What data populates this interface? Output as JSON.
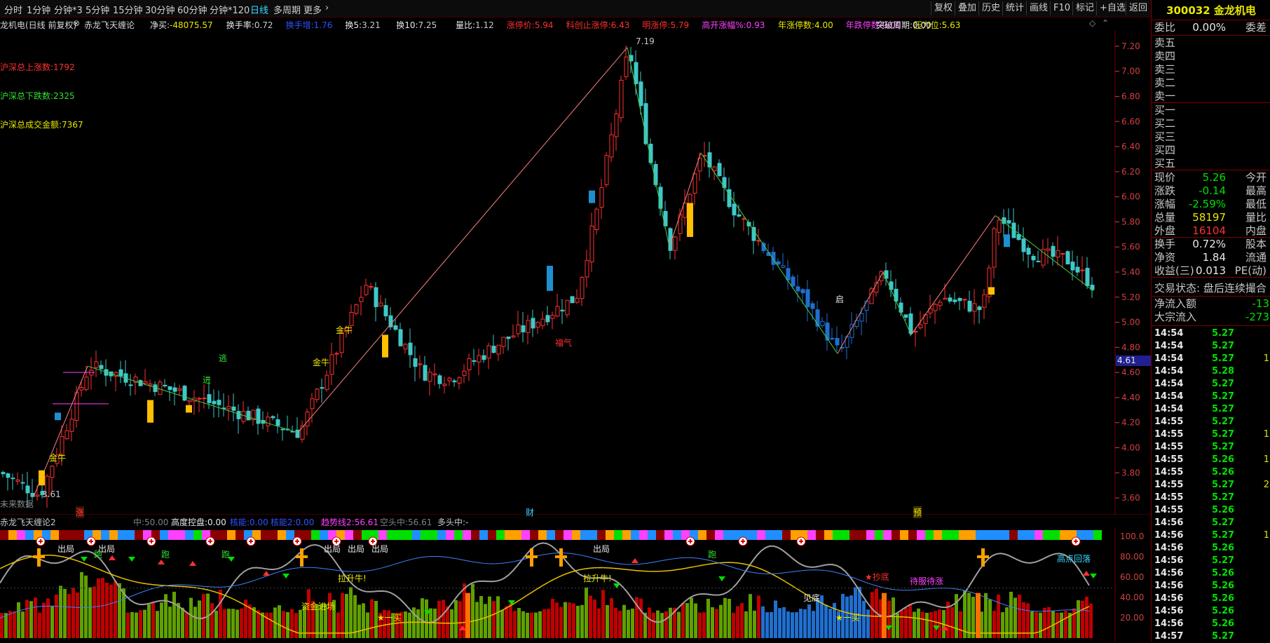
{
  "toolbar": {
    "periods": [
      "分时",
      "1分钟",
      "分钟*3",
      "5分钟",
      "15分钟",
      "30分钟",
      "60分钟",
      "分钟*120",
      "日线",
      "多周期",
      "更多"
    ],
    "active_period": "日线",
    "right_buttons": [
      "复权",
      "叠加",
      "历史",
      "统计",
      "画线",
      "F10",
      "标记",
      "+自选",
      "返回"
    ]
  },
  "chart_header": {
    "stock_label": "龙机电(日线 前复权)",
    "indicator_name": "赤龙飞天缠论",
    "stats": [
      {
        "label": "净买:",
        "value": "-48075.57",
        "color": "#e8e800"
      },
      {
        "label": "换手率:",
        "value": "0.72",
        "color": "#c8c8c8"
      },
      {
        "label": "换手增:",
        "value": "1.76",
        "color": "#3050ff"
      },
      {
        "label": "换5:",
        "value": "3.21",
        "color": "#c8c8c8"
      },
      {
        "label": "换10:",
        "value": "7.25",
        "color": "#c8c8c8"
      },
      {
        "label": "量比:",
        "value": "1.12",
        "color": "#c8c8c8"
      },
      {
        "label": "涨停价:",
        "value": "5.94",
        "color": "#ff3030"
      },
      {
        "label": "科创止涨停:",
        "value": "6.43",
        "color": "#ff3030"
      },
      {
        "label": "明涨停:",
        "value": "5.79",
        "color": "#ff3030"
      },
      {
        "label": "高开涨幅%:",
        "value": "0.93",
        "color": "#ff40ff"
      },
      {
        "label": "年涨停数:",
        "value": "4.00",
        "color": "#e8e800"
      },
      {
        "label": "年跌停数:",
        "value": "0.00",
        "color": "#ff40ff"
      },
      {
        "label": "压力位:",
        "value": "5.63",
        "color": "#e8e800"
      },
      {
        "label": "突破周期:",
        "value": "0.00",
        "color": "#e8e8e8"
      }
    ]
  },
  "left_stats": [
    {
      "text": "沪深总上涨数:1792",
      "color": "#ff3030"
    },
    {
      "text": "沪深总下跌数:2325",
      "color": "#30e030"
    },
    {
      "text": "沪深总成交金额:7367",
      "color": "#e8e800"
    }
  ],
  "price_axis": [
    "7.20",
    "7.00",
    "6.80",
    "6.60",
    "6.40",
    "6.20",
    "6.00",
    "5.80",
    "5.60",
    "5.40",
    "5.20",
    "5.00",
    "4.80",
    "4.60",
    "4.40",
    "4.20",
    "4.00",
    "3.80",
    "3.60"
  ],
  "price_marker": "4.61",
  "chart_annotations": {
    "high": "7.19",
    "low": "3.61",
    "future_note": "未来数据",
    "markers": [
      "涨",
      "财",
      "预"
    ],
    "labels": [
      "金牛",
      "金牛",
      "金牛",
      "逃",
      "进",
      "福气",
      "启"
    ]
  },
  "indicator2": {
    "name": "赤龙飞天缠论2",
    "stats": [
      {
        "label": "中:",
        "value": "50.00",
        "color": "#808080"
      },
      {
        "label": "高度控盘:",
        "value": "0.00",
        "color": "#e8e8e8"
      },
      {
        "label": "核能:",
        "value": "0.00",
        "color": "#3050ff"
      },
      {
        "label": "核能2:",
        "value": "0.00",
        "color": "#3050ff"
      },
      {
        "label": "趋势线2:",
        "value": "56.61",
        "color": "#ff40ff"
      },
      {
        "label": "空头中:",
        "value": "56.61",
        "color": "#808080"
      },
      {
        "label": "多头中:",
        "value": "-",
        "color": "#c8c8c8"
      }
    ],
    "axis": [
      "100.0",
      "80.00",
      "60.00",
      "40.00",
      "20.00"
    ],
    "labels": [
      "出局",
      "出局",
      "出局",
      "出局",
      "出局",
      "出局",
      "跑",
      "跑",
      "跑",
      "跑",
      "拉升牛!",
      "拉升牛!",
      "资金进场",
      "★一买",
      "见底",
      "★抄底",
      "待服待涨",
      "★一买",
      "高点回落"
    ]
  },
  "quote": {
    "code": "300032",
    "name": "金龙机电",
    "weibi_label": "委比",
    "weibi": "0.00%",
    "weicha_label": "委差",
    "asks": [
      "卖五",
      "卖四",
      "卖三",
      "卖二",
      "卖一"
    ],
    "bids": [
      "买一",
      "买二",
      "买三",
      "买四",
      "买五"
    ],
    "rows": [
      {
        "l": "现价",
        "v": "5.26",
        "c": "#00e000",
        "r": "今开"
      },
      {
        "l": "涨跌",
        "v": "-0.14",
        "c": "#00e000",
        "r": "最高"
      },
      {
        "l": "涨幅",
        "v": "-2.59%",
        "c": "#00e000",
        "r": "最低"
      },
      {
        "l": "总量",
        "v": "58197",
        "c": "#e8e800",
        "r": "量比"
      },
      {
        "l": "外盘",
        "v": "16104",
        "c": "#ff3030",
        "r": "内盘"
      },
      {
        "l": "换手",
        "v": "0.72%",
        "c": "#e8e8e8",
        "r": "股本"
      },
      {
        "l": "净资",
        "v": "1.84",
        "c": "#e8e8e8",
        "r": "流通"
      },
      {
        "l": "收益(三)",
        "v": "0.013",
        "c": "#e8e8e8",
        "r": "PE(动)"
      }
    ],
    "trade_status": "交易状态: 盘后连续撮合",
    "net_inflow_label": "净流入额",
    "net_inflow": "-13",
    "block_inflow_label": "大宗流入",
    "block_inflow": "-273"
  },
  "ticks": [
    {
      "t": "14:54",
      "p": "5.27",
      "v": ""
    },
    {
      "t": "14:54",
      "p": "5.27",
      "v": ""
    },
    {
      "t": "14:54",
      "p": "5.27",
      "v": "1"
    },
    {
      "t": "14:54",
      "p": "5.28",
      "v": ""
    },
    {
      "t": "14:54",
      "p": "5.27",
      "v": ""
    },
    {
      "t": "14:54",
      "p": "5.27",
      "v": ""
    },
    {
      "t": "14:54",
      "p": "5.27",
      "v": ""
    },
    {
      "t": "14:55",
      "p": "5.27",
      "v": ""
    },
    {
      "t": "14:55",
      "p": "5.27",
      "v": "1"
    },
    {
      "t": "14:55",
      "p": "5.27",
      "v": ""
    },
    {
      "t": "14:55",
      "p": "5.26",
      "v": "1"
    },
    {
      "t": "14:55",
      "p": "5.26",
      "v": ""
    },
    {
      "t": "14:55",
      "p": "5.27",
      "v": "2"
    },
    {
      "t": "14:55",
      "p": "5.27",
      "v": ""
    },
    {
      "t": "14:55",
      "p": "5.26",
      "v": ""
    },
    {
      "t": "14:56",
      "p": "5.27",
      "v": ""
    },
    {
      "t": "14:56",
      "p": "5.27",
      "v": "1"
    },
    {
      "t": "14:56",
      "p": "5.26",
      "v": ""
    },
    {
      "t": "14:56",
      "p": "5.27",
      "v": ""
    },
    {
      "t": "14:56",
      "p": "5.26",
      "v": ""
    },
    {
      "t": "14:56",
      "p": "5.26",
      "v": ""
    },
    {
      "t": "14:56",
      "p": "5.26",
      "v": ""
    },
    {
      "t": "14:56",
      "p": "5.26",
      "v": ""
    },
    {
      "t": "14:56",
      "p": "5.26",
      "v": ""
    },
    {
      "t": "14:57",
      "p": "5.27",
      "v": ""
    }
  ],
  "colors": {
    "up": "#ff3030",
    "down": "#00e000",
    "accent": "#38d8ff",
    "border": "#7a0000"
  }
}
